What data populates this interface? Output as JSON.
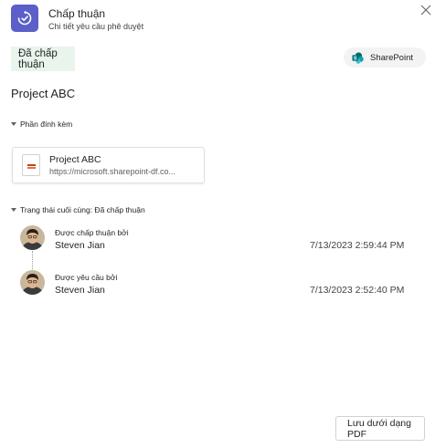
{
  "header": {
    "title": "Chấp thuận",
    "subtitle": "Chi tiết yêu cầu phê duyệt",
    "app_icon": "approvals-icon",
    "close_icon": "close-icon"
  },
  "status": {
    "label": "Đã chấp thuận",
    "color": "#e9f5ec"
  },
  "source_chip": {
    "label": "SharePoint",
    "icon": "sharepoint-icon"
  },
  "request": {
    "title": "Project ABC"
  },
  "attachments": {
    "heading": "Phần đính kèm",
    "items": [
      {
        "name": "Project ABC",
        "url": "https://microsoft.sharepoint-df.co...",
        "icon": "powerpoint-file-icon"
      }
    ]
  },
  "history": {
    "heading": "Trạng thái cuối cùng: Đã chấp thuận",
    "events": [
      {
        "label": "Được chấp thuận bởi",
        "name": "Steven Jian",
        "time": "7/13/2023 2:59:44 PM"
      },
      {
        "label": "Được yêu cầu bởi",
        "name": "Steven Jian",
        "time": "7/13/2023 2:52:40 PM"
      }
    ]
  },
  "footer": {
    "save_pdf_label": "Lưu dưới dạng PDF"
  },
  "colors": {
    "brand": "#5b5fc7",
    "approved_bg": "#e9f5ec",
    "sharepoint": "#038387"
  }
}
